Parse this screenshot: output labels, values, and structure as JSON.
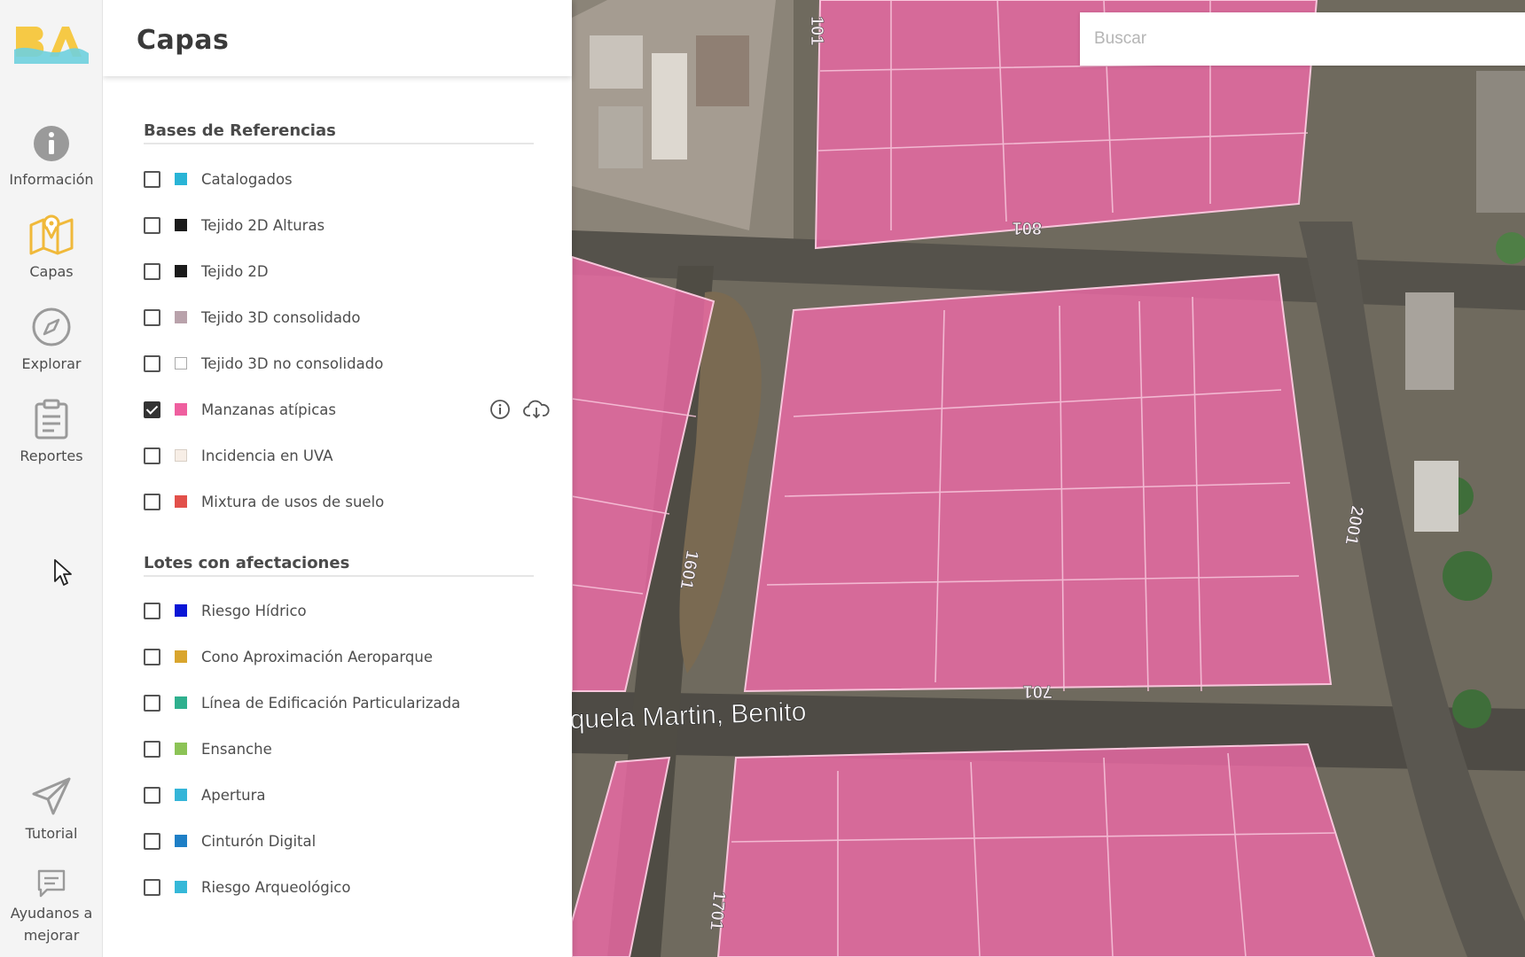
{
  "rail": {
    "items": [
      {
        "label": "Información",
        "icon": "info-icon"
      },
      {
        "label": "Capas",
        "icon": "map-layers-icon"
      },
      {
        "label": "Explorar",
        "icon": "compass-icon"
      },
      {
        "label": "Reportes",
        "icon": "clipboard-icon"
      },
      {
        "label": "Tutorial",
        "icon": "paper-plane-icon"
      },
      {
        "label": "Ayudanos a mejorar",
        "icon": "feedback-icon"
      }
    ],
    "active": "Capas",
    "colors": {
      "logo_yellow": "#f6c945",
      "logo_cyan": "#6fd0de",
      "active_icon": "#f0b93a",
      "inactive_icon": "#9a9a9a"
    }
  },
  "panel": {
    "title": "Capas",
    "sections": [
      {
        "title": "Bases de Referencias",
        "layers": [
          {
            "label": "Catalogados",
            "color": "#29b4d6",
            "checked": false
          },
          {
            "label": "Tejido 2D Alturas",
            "color": "#1b1b1b",
            "checked": false
          },
          {
            "label": "Tejido 2D",
            "color": "#1b1b1b",
            "checked": false
          },
          {
            "label": "Tejido 3D consolidado",
            "color": "#b9a2ab",
            "checked": false
          },
          {
            "label": "Tejido 3D no consolidado",
            "color": "#ffffff",
            "checked": false
          },
          {
            "label": "Manzanas atípicas",
            "color": "#ef5f9f",
            "checked": true,
            "actions": [
              "info-icon",
              "cloud-download-icon"
            ]
          },
          {
            "label": "Incidencia en UVA",
            "color": "#f7eee6",
            "checked": false
          },
          {
            "label": "Mixtura de usos de suelo",
            "color": "#e2504a",
            "checked": false
          }
        ]
      },
      {
        "title": "Lotes con afectaciones",
        "layers": [
          {
            "label": "Riesgo Hídrico",
            "color": "#0a16d6",
            "checked": false
          },
          {
            "label": "Cono Aproximación Aeroparque",
            "color": "#d9a52e",
            "checked": false
          },
          {
            "label": "Línea de Edificación Particularizada",
            "color": "#2fb08e",
            "checked": false
          },
          {
            "label": "Ensanche",
            "color": "#8cc356",
            "checked": false
          },
          {
            "label": "Apertura",
            "color": "#35b5d8",
            "checked": false
          },
          {
            "label": "Cinturón Digital",
            "color": "#1e7fc6",
            "checked": false
          },
          {
            "label": "Riesgo Arqueológico",
            "color": "#35b8d8",
            "checked": false
          }
        ]
      }
    ]
  },
  "search": {
    "placeholder": "Buscar",
    "value": ""
  },
  "map": {
    "street_label": "quela Martin, Benito",
    "street_numbers": [
      "101",
      "801",
      "1601",
      "701",
      "2001",
      "1701"
    ],
    "overlay_color": "#f06aa8",
    "base_color": "#6f6a5e"
  }
}
